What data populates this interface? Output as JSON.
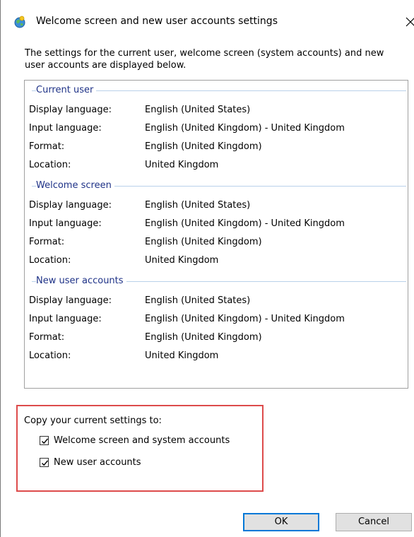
{
  "window": {
    "title": "Welcome screen and new user accounts settings",
    "app_icon": "globe-icon",
    "close_icon": "close-icon"
  },
  "intro_text": "The settings for the current user, welcome screen (system accounts) and new user accounts are displayed below.",
  "groups": [
    {
      "title": "Current user",
      "rows": [
        {
          "label": "Display language:",
          "value": "English (United States)"
        },
        {
          "label": "Input language:",
          "value": "English (United Kingdom) - United Kingdom"
        },
        {
          "label": "Format:",
          "value": "English (United Kingdom)"
        },
        {
          "label": "Location:",
          "value": "United Kingdom"
        }
      ]
    },
    {
      "title": "Welcome screen",
      "rows": [
        {
          "label": "Display language:",
          "value": "English (United States)"
        },
        {
          "label": "Input language:",
          "value": "English (United Kingdom) - United Kingdom"
        },
        {
          "label": "Format:",
          "value": "English (United Kingdom)"
        },
        {
          "label": "Location:",
          "value": "United Kingdom"
        }
      ]
    },
    {
      "title": "New user accounts",
      "rows": [
        {
          "label": "Display language:",
          "value": "English (United States)"
        },
        {
          "label": "Input language:",
          "value": "English (United Kingdom) - United Kingdom"
        },
        {
          "label": "Format:",
          "value": "English (United Kingdom)"
        },
        {
          "label": "Location:",
          "value": "United Kingdom"
        }
      ]
    }
  ],
  "copy_settings": {
    "title": "Copy your current settings to:",
    "options": [
      {
        "label": "Welcome screen and system accounts",
        "checked": true
      },
      {
        "label": "New user accounts",
        "checked": true
      }
    ]
  },
  "buttons": {
    "ok": "OK",
    "cancel": "Cancel"
  },
  "colors": {
    "group_title": "#1e3287",
    "group_line": "#b9d1ea",
    "highlight_border": "#dd4b4b",
    "default_button_border": "#0078d7",
    "button_bg": "#e1e1e1"
  }
}
